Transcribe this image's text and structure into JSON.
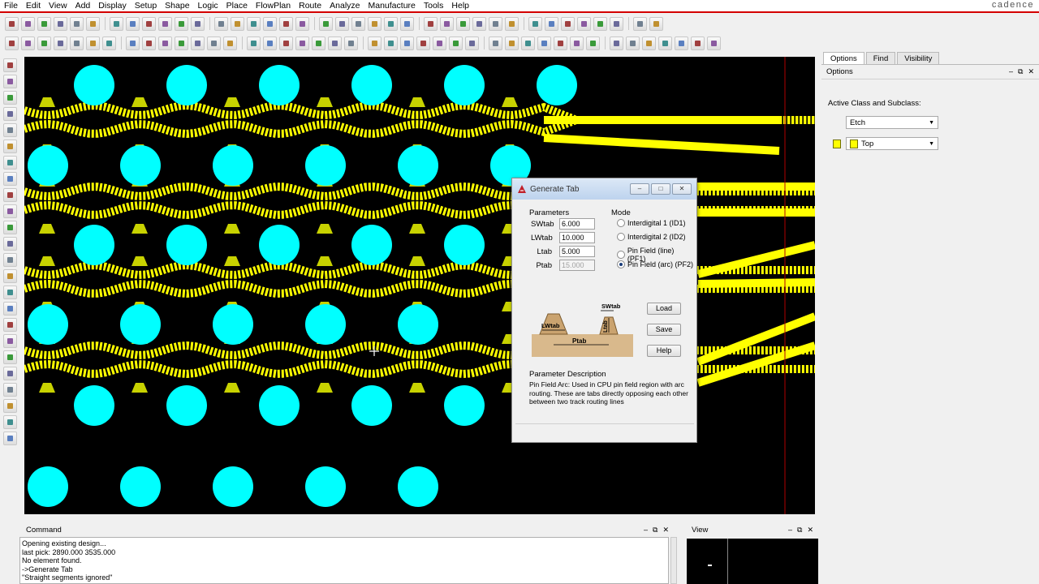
{
  "menu": [
    "File",
    "Edit",
    "View",
    "Add",
    "Display",
    "Setup",
    "Shape",
    "Logic",
    "Place",
    "FlowPlan",
    "Route",
    "Analyze",
    "Manufacture",
    "Tools",
    "Help"
  ],
  "brand": "cadence",
  "right_panel": {
    "tabs": [
      "Options",
      "Find",
      "Visibility"
    ],
    "options_header": "Options",
    "active_class_label": "Active Class and Subclass:",
    "class_value": "Etch",
    "subclass_value": "Top",
    "layer_color": "#ffff00"
  },
  "command": {
    "title": "Command",
    "lines": [
      "Opening existing design...",
      "last pick:  2890.000 3535.000",
      "No element found.",
      "->Generate Tab",
      "\"Straight segments ignored\""
    ]
  },
  "view": {
    "title": "View"
  },
  "dialog": {
    "title": "Generate Tab",
    "parameters_label": "Parameters",
    "mode_label": "Mode",
    "params": [
      {
        "label": "SWtab",
        "value": "6.000",
        "enabled": true
      },
      {
        "label": "LWtab",
        "value": "10.000",
        "enabled": true
      },
      {
        "label": "Ltab",
        "value": "5.000",
        "enabled": true
      },
      {
        "label": "Ptab",
        "value": "15.000",
        "enabled": false
      }
    ],
    "modes": [
      {
        "label": "Interdigital 1  (ID1)",
        "selected": false
      },
      {
        "label": "Interdigital 2  (ID2)",
        "selected": false
      },
      {
        "label": "Pin Field (line) (PF1)",
        "selected": false
      },
      {
        "label": "Pin Field (arc) (PF2)",
        "selected": true
      }
    ],
    "buttons": {
      "load": "Load",
      "save": "Save",
      "help": "Help"
    },
    "diagram_labels": {
      "swtab": "SWtab",
      "lwtab": "LWtab",
      "ltab": "Ltab",
      "ptab": "Ptab"
    },
    "description_title": "Parameter Description",
    "description": "Pin Field Arc: Used in CPU pin field region with arc routing. These are tabs directly opposing each other between two track routing lines"
  },
  "colors": {
    "pad": "#00ffff",
    "trace": "#ffff00",
    "tab": "#c8d200",
    "canvas": "#000000"
  }
}
